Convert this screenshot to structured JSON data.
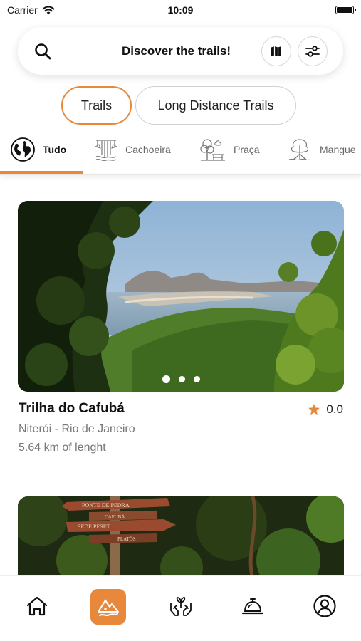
{
  "status_bar": {
    "carrier": "Carrier",
    "time": "10:09"
  },
  "search": {
    "title": "Discover the trails!"
  },
  "segments": [
    {
      "label": "Trails",
      "active": true
    },
    {
      "label": "Long Distance Trails",
      "active": false
    }
  ],
  "categories": [
    {
      "label": "Tudo",
      "icon": "globe-icon",
      "active": true
    },
    {
      "label": "Cachoeira",
      "icon": "waterfall-icon",
      "active": false
    },
    {
      "label": "Praça",
      "icon": "park-icon",
      "active": false
    },
    {
      "label": "Mangue",
      "icon": "mangrove-tree-icon",
      "active": false
    }
  ],
  "cards": [
    {
      "title": "Trilha do Cafubá",
      "rating": "0.0",
      "location": "Niterói - Rio de Janeiro",
      "length": "5.64 km of lenght",
      "image_dots": 3,
      "active_dot": 1
    },
    {
      "signpost": [
        "PONTE DE PEDRA",
        "CAFUBÁ",
        "SEDE PESET",
        "PLATÔS"
      ]
    }
  ],
  "tab_bar": [
    {
      "icon": "home-icon",
      "active": false
    },
    {
      "icon": "mountain-trails-icon",
      "active": true
    },
    {
      "icon": "hands-plant-icon",
      "active": false
    },
    {
      "icon": "service-bell-icon",
      "active": false
    },
    {
      "icon": "profile-icon",
      "active": false
    }
  ],
  "colors": {
    "accent": "#e8883a",
    "text": "#111111",
    "muted": "#777777"
  }
}
